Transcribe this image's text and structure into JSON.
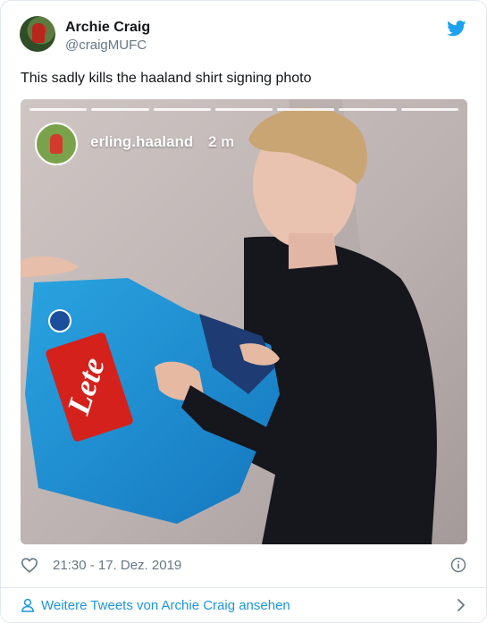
{
  "author": {
    "name": "Archie Craig",
    "handle": "@craigMUFC"
  },
  "tweet": {
    "text": "This sadly kills the haaland shirt signing photo",
    "timestamp": "21:30 - 17. Dez. 2019"
  },
  "story": {
    "username": "erling.haaland",
    "age": "2 m",
    "shirt_sponsor": "Lete",
    "progress_segments": 7
  },
  "footer": {
    "more_tweets": "Weitere Tweets von Archie Craig ansehen"
  },
  "icons": {
    "brand": "twitter-bird-icon",
    "like": "heart-icon",
    "info": "info-icon",
    "profile": "person-icon",
    "next": "chevron-right-icon"
  },
  "colors": {
    "accent": "#1da1f2",
    "link": "#1b95e0",
    "secondary_text": "#657786",
    "border": "#e1e8ed"
  }
}
